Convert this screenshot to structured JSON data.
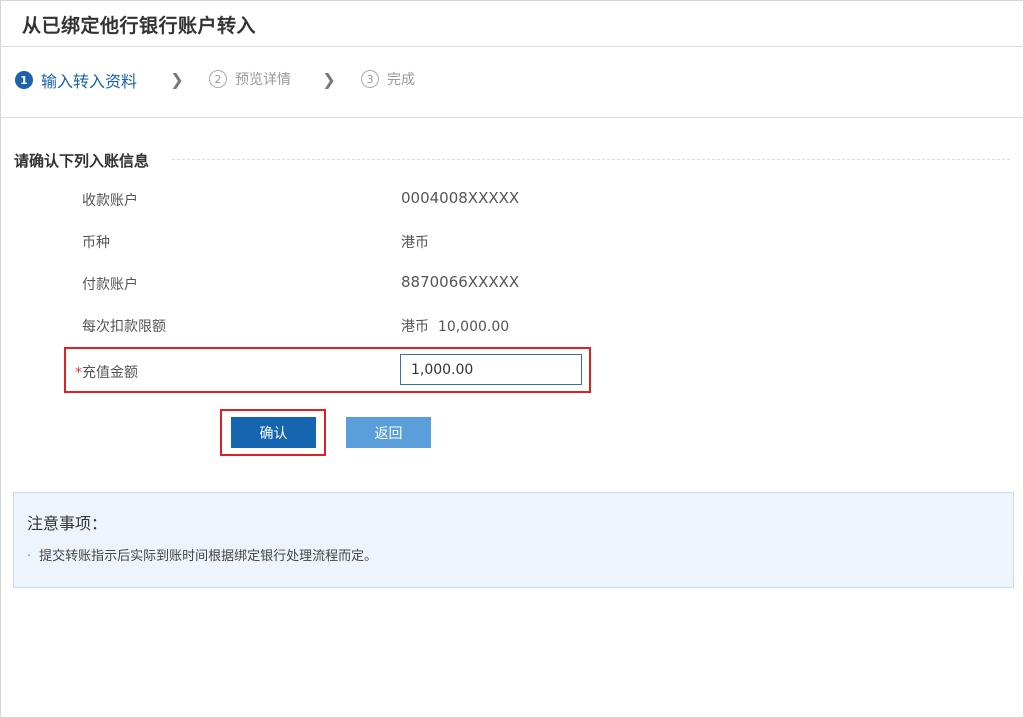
{
  "page": {
    "title": "从已绑定他行银行账户转入"
  },
  "steps": [
    {
      "num": "1",
      "label": "输入转入资料",
      "active": true
    },
    {
      "num": "2",
      "label": "预览详情",
      "active": false
    },
    {
      "num": "3",
      "label": "完成",
      "active": false
    }
  ],
  "section": {
    "title": "请确认下列入账信息"
  },
  "fields": {
    "payee_account": {
      "label": "收款账户",
      "value": "0004008XXXXX"
    },
    "currency": {
      "label": "币种",
      "value": "港币"
    },
    "payer_account": {
      "label": "付款账户",
      "value": "8870066XXXXX"
    },
    "limit": {
      "label": "每次扣款限额",
      "currency": "港币",
      "value": "10,000.00"
    },
    "amount": {
      "required_mark": "*",
      "label": "充值金额",
      "value": "1,000.00"
    }
  },
  "buttons": {
    "confirm": "确认",
    "back": "返回"
  },
  "notice": {
    "title": "注意事项：",
    "items": [
      "提交转账指示后实际到账时间根据绑定银行处理流程而定。"
    ]
  },
  "colors": {
    "primary": "#1565b0",
    "secondary_button": "#5a9fdc",
    "highlight": "#e02020",
    "notice_bg": "#eef4fb"
  }
}
